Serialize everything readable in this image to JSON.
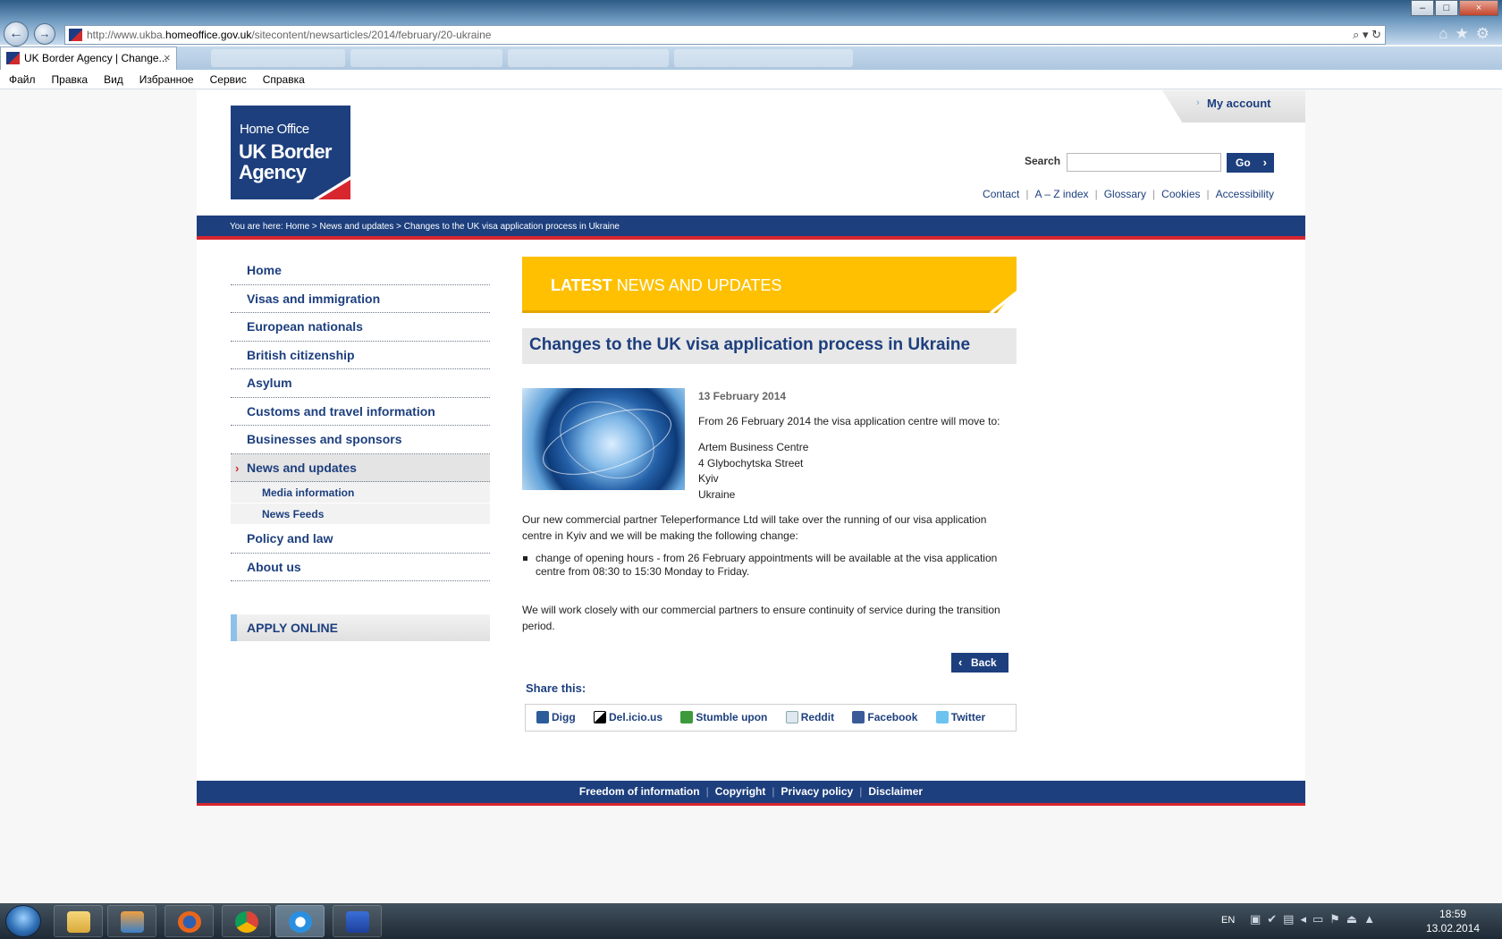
{
  "browser": {
    "url_prefix": "http://www.ukba.",
    "url_host": "homeoffice.gov.uk",
    "url_path": "/sitecontent/newsarticles/2014/february/20-ukraine",
    "tab_title": "UK Border Agency | Change...",
    "tab_close": "×",
    "menu": [
      "Файл",
      "Правка",
      "Вид",
      "Избранное",
      "Сервис",
      "Справка"
    ],
    "window_controls": [
      "–",
      "□",
      "×"
    ]
  },
  "header": {
    "logo_line1": "Home Office",
    "logo_line2a": "UK Border",
    "logo_line2b": "Agency",
    "my_account": "My account",
    "search_label": "Search",
    "search_value": "",
    "go_label": "Go",
    "util_links": [
      "Contact",
      "A – Z index",
      "Glossary",
      "Cookies",
      "Accessibility"
    ]
  },
  "breadcrumb": "You are here: Home > News and updates > Changes to the UK visa application process in Ukraine",
  "nav": {
    "items": [
      "Home",
      "Visas and immigration",
      "European nationals",
      "British citizenship",
      "Asylum",
      "Customs and travel information",
      "Businesses and sponsors",
      "News and updates"
    ],
    "sub_items": [
      "Media information",
      "News Feeds"
    ],
    "items_after": [
      "Policy and law",
      "About us"
    ],
    "apply_online": "APPLY ONLINE"
  },
  "banner": {
    "bold": "LATEST",
    "rest": "NEWS AND UPDATES"
  },
  "article": {
    "title": "Changes to the UK visa application process in Ukraine",
    "date": "13 February 2014",
    "intro": "From 26 February 2014 the visa application centre will move to:",
    "address": [
      "Artem Business Centre",
      "4 Glybochytska Street",
      "Kyiv",
      "Ukraine"
    ],
    "para2": "Our new commercial partner Teleperformance Ltd will take over the running of our visa application centre in Kyiv and we will be making the following change:",
    "bullet": "change of opening hours - from 26 February appointments will be available at the visa application centre from 08:30 to 15:30 Monday to Friday.",
    "para3": "We will work closely with our commercial partners to ensure continuity of service during the transition period.",
    "back": "Back"
  },
  "share": {
    "title": "Share this:",
    "items": [
      "Digg",
      "Del.icio.us",
      "Stumble upon",
      "Reddit",
      "Facebook",
      "Twitter"
    ]
  },
  "footer": {
    "links": [
      "Freedom of information",
      "Copyright",
      "Privacy policy",
      "Disclaimer"
    ]
  },
  "taskbar": {
    "lang": "EN",
    "time": "18:59",
    "date": "13.02.2014"
  },
  "colors": {
    "brand_navy": "#1d3f7e",
    "brand_red": "#d8262f",
    "banner_yellow": "#fec000"
  }
}
